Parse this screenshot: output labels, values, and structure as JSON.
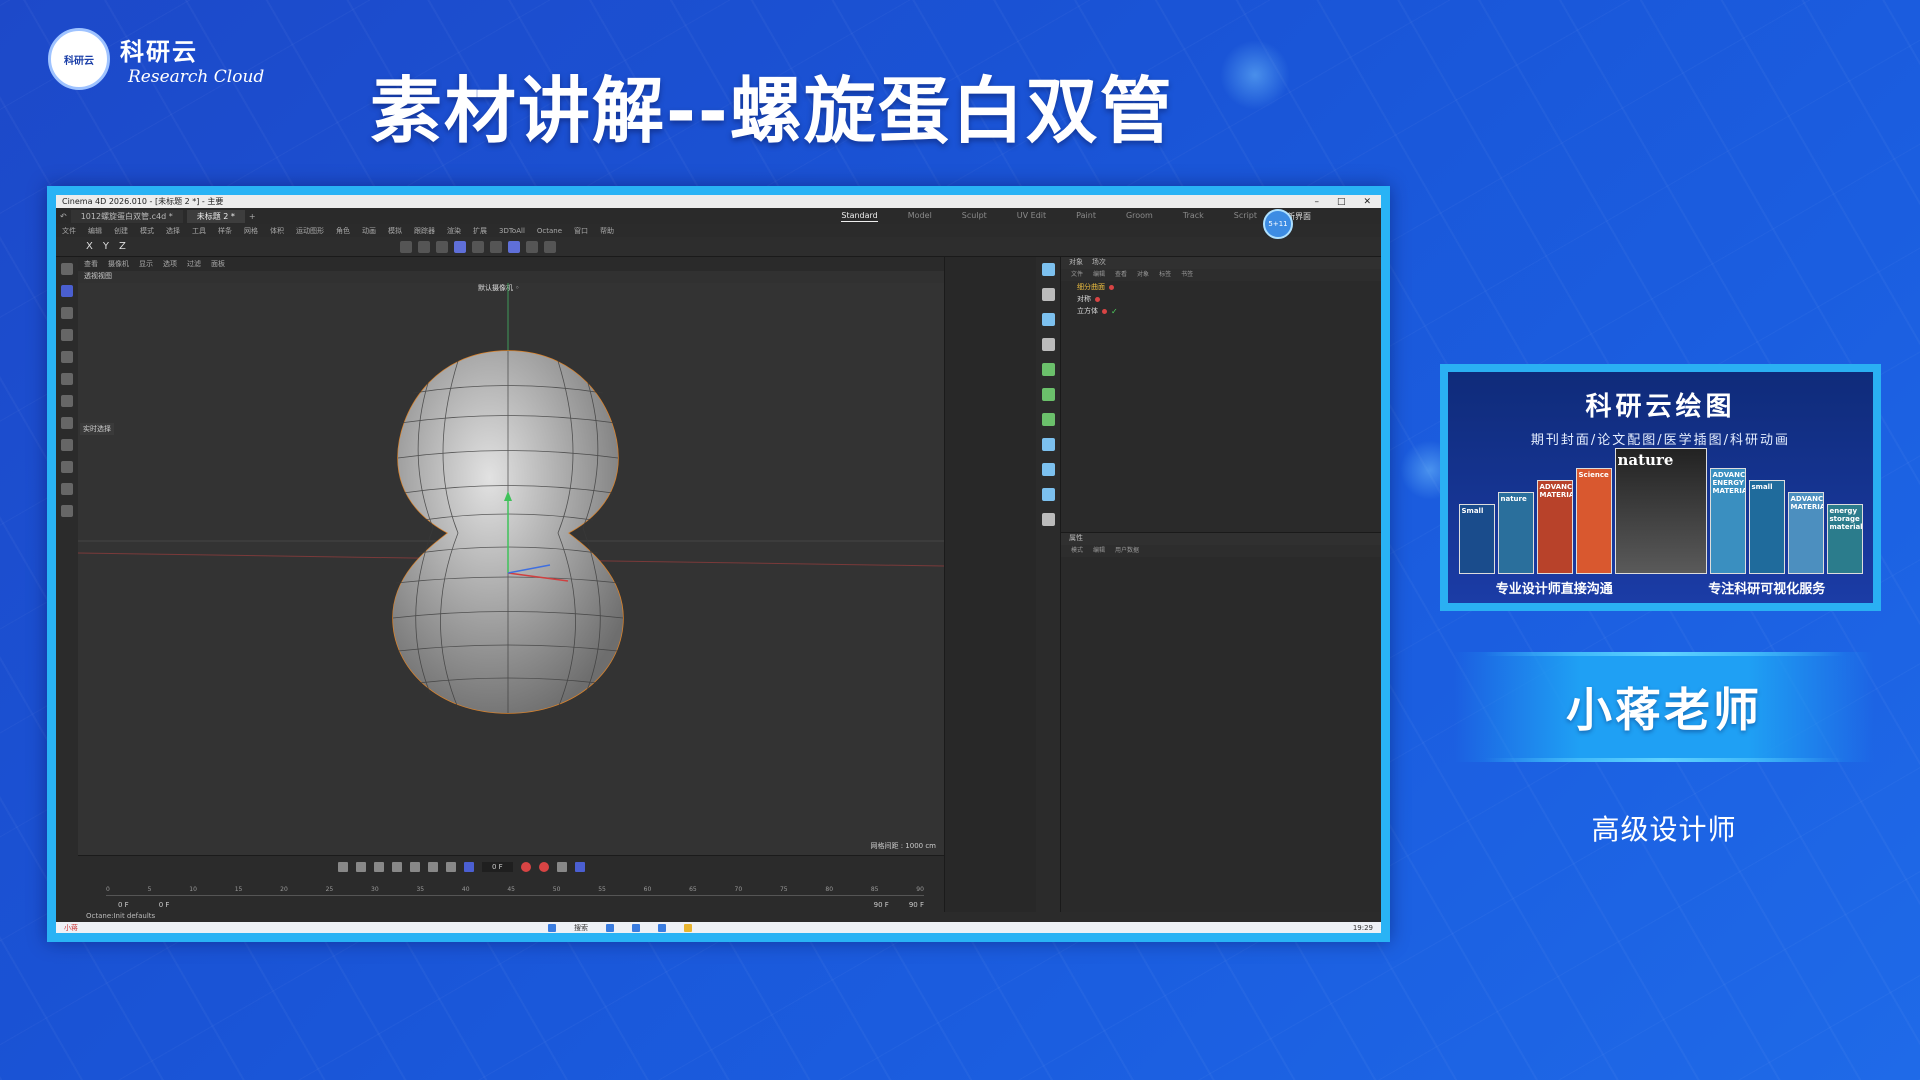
{
  "brand": {
    "cn": "科研云",
    "en": "Research Cloud",
    "logo_text": "科研云"
  },
  "title": "素材讲解--螺旋蛋白双管",
  "c4d": {
    "window_title": "Cinema 4D 2026.010 - [未标题 2 *] - 主要",
    "tabs": [
      "1012螺旋蛋白双管.c4d *",
      "未标题 2 *"
    ],
    "layout_tabs": [
      "Standard",
      "Model",
      "Sculpt",
      "UV Edit",
      "Paint",
      "Groom",
      "Track",
      "Script"
    ],
    "new_layout": "新界面",
    "avatar": "5+11",
    "menu": [
      "文件",
      "编辑",
      "创建",
      "模式",
      "选择",
      "工具",
      "样条",
      "网格",
      "体积",
      "运动图形",
      "角色",
      "动画",
      "模拟",
      "跟踪器",
      "渲染",
      "扩展",
      "3DToAll",
      "Octane",
      "窗口",
      "帮助"
    ],
    "axes": [
      "X",
      "Y",
      "Z"
    ],
    "viewport_menu": [
      "查看",
      "摄像机",
      "显示",
      "选项",
      "过滤",
      "面板"
    ],
    "view_name": "透视视图",
    "camera": "默认摄像机 ◦︎",
    "filter_label": "实时选择",
    "grid_info": "网格间距 : 1000 cm",
    "timeline_frame": "0 F",
    "timeline_start": [
      "0 F",
      "0 F"
    ],
    "timeline_end": [
      "90 F",
      "90 F"
    ],
    "ruler": [
      "0",
      "5",
      "10",
      "15",
      "20",
      "25",
      "30",
      "35",
      "40",
      "45",
      "50",
      "55",
      "60",
      "65",
      "70",
      "75",
      "80",
      "85",
      "90"
    ],
    "objects_tabs": [
      "对象",
      "场次"
    ],
    "objects_menu": [
      "文件",
      "编辑",
      "查看",
      "对象",
      "标签",
      "书签"
    ],
    "objects": [
      "细分曲面",
      "对称",
      "立方体"
    ],
    "attributes_tab": "属性",
    "attributes_menu": [
      "模式",
      "编辑",
      "用户数据"
    ],
    "status": "Octane:Init defaults",
    "taskbar_search": "搜索",
    "taskbar_user": "小蒋",
    "time": "19:29"
  },
  "ad": {
    "title": "科研云绘图",
    "subtitle": "期刊封面/论文配图/医学插图/科研动画",
    "covers": [
      "Small",
      "nature",
      "ADVANCED MATERIALS",
      "Science",
      "nature",
      "ADVANCED ENERGY MATERIALS",
      "small",
      "ADVANCED MATERIALS",
      "energy storage materials"
    ],
    "bottom_left": "专业设计师直接沟通",
    "bottom_right": "专注科研可视化服务"
  },
  "presenter": {
    "name": "小蒋老师",
    "role": "高级设计师"
  }
}
